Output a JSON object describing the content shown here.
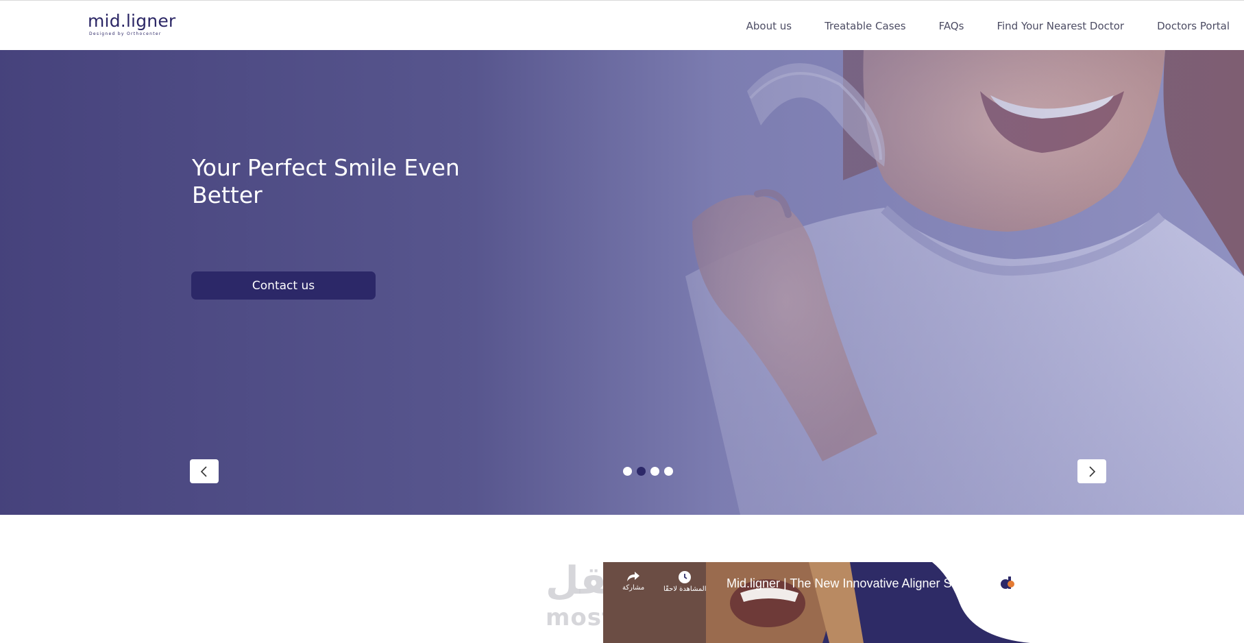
{
  "header": {
    "logo": {
      "name": "mid.ligner",
      "tagline": "Designed by Orthocenter"
    },
    "nav": [
      "About us",
      "Treatable Cases",
      "FAQs",
      "Find Your Nearest Doctor",
      "Doctors Portal"
    ]
  },
  "hero": {
    "title": "Your Perfect Smile Even Better",
    "cta_label": "Contact us",
    "slides": {
      "total": 4,
      "active_index": 1
    },
    "overlay_color": "#44407a"
  },
  "video": {
    "title": "Mid.ligner | The New Innovative Aligner Solution",
    "actions": {
      "share_label": "مشاركة",
      "watch_later_label": "المشاهدة لاحقًا"
    }
  },
  "watermark": {
    "arabic": "مستقل",
    "latin": "mostaql.com"
  },
  "colors": {
    "brand": "#2c2868",
    "nav_text": "#4c4c63",
    "hero_overlay": "#4b4a7e"
  },
  "icons": {
    "prev": "chevron-left-icon",
    "next": "chevron-right-icon",
    "share": "share-arrow-icon",
    "watch_later": "clock-icon"
  }
}
